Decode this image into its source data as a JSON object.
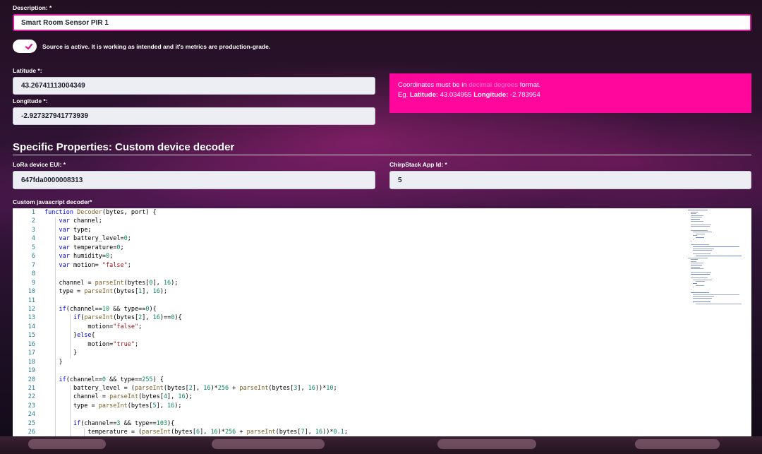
{
  "form": {
    "description_label": "Description: *",
    "description_value": "Smart Room Sensor PIR 1",
    "active_toggle_label": "Source is active. It is working as intended and it's metrics are production-grade.",
    "active_toggle_on": true,
    "latitude_label": "Latitude *:",
    "latitude_value": "43.26741113004349",
    "longitude_label": "Longitude *:",
    "longitude_value": "-2.927327941773939"
  },
  "info_box": {
    "line1_before": "Coordinates must be in",
    "line1_highlight": "decimal degrees",
    "line1_after": "format.",
    "line2_prefix": "Eg.",
    "lat_label": "Latitude:",
    "lat_value": "43.034955",
    "lon_label": "Longitude:",
    "lon_value": "-2.783954"
  },
  "specific": {
    "title": "Specific Properties: Custom device decoder",
    "lora_label": "LoRa device EUI: *",
    "lora_value": "647fda0000008313",
    "chirp_label": "ChirpStack App Id: *",
    "chirp_value": "5",
    "decoder_label": "Custom javascript decoder*"
  },
  "editor": {
    "lines": [
      "function Decoder(bytes, port) {",
      "    var channel;",
      "    var type;",
      "    var battery_level=0;",
      "    var temperature=0;",
      "    var humidity=0;",
      "    var motion= \"false\";",
      "",
      "    channel = parseInt(bytes[0], 16);",
      "    type = parseInt(bytes[1], 16);",
      "",
      "    if(channel==10 && type==0){",
      "        if(parseInt(bytes[2], 16)==0){",
      "            motion=\"false\";",
      "        }else{",
      "            motion=\"true\";",
      "        }",
      "    }",
      "",
      "    if(channel==0 && type==255) {",
      "        battery_level = (parseInt(bytes[2], 16)*256 + parseInt(bytes[3], 16))*10;",
      "        channel = parseInt(bytes[4], 16);",
      "        type = parseInt(bytes[5], 16);",
      "",
      "        if(channel==3 && type==103){",
      "            temperature = (parseInt(bytes[6], 16)*256 + parseInt(bytes[7], 16))*0.1;"
    ]
  },
  "colors": {
    "accent": "#ff069c",
    "focus_border": "#d61a9c",
    "field_bg": "#edeef4"
  }
}
